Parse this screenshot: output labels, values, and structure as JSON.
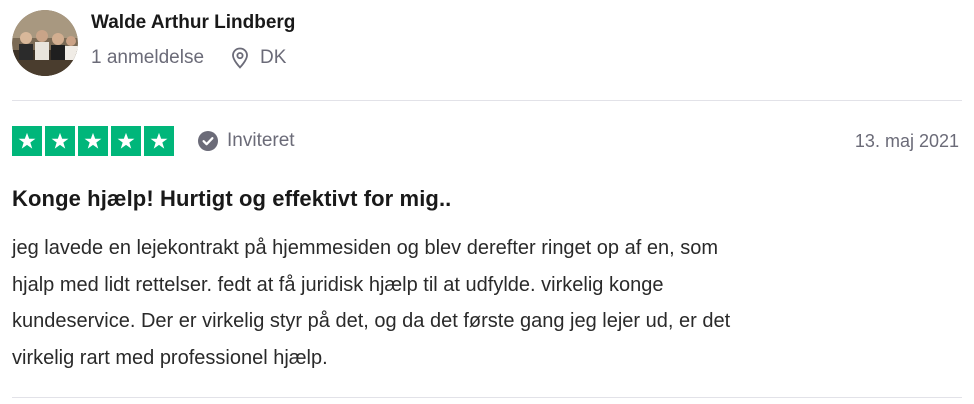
{
  "consumer": {
    "name": "Walde Arthur Lindberg",
    "review_count": "1 anmeldelse",
    "country": "DK",
    "avatar_icon": "avatar-photo"
  },
  "review": {
    "rating": 5,
    "max_rating": 5,
    "star_color": "#00b67a",
    "verification_label": "Inviteret",
    "date": "13. maj 2021",
    "title": "Konge hjælp! Hurtigt og effektivt for mig..",
    "body_lines": [
      "jeg lavede en lejekontrakt på hjemmesiden og blev derefter ringet op af en, som",
      "hjalp med lidt rettelser. fedt at få juridisk hjælp til at udfylde. virkelig konge",
      "kundeservice. Der er virkelig styr på det, og da det første gang jeg lejer ud, er det",
      "virkelig rart med professionel hjælp."
    ]
  },
  "icons": {
    "location": "location-pin-icon",
    "verified": "check-circle-icon",
    "star": "star-icon"
  }
}
